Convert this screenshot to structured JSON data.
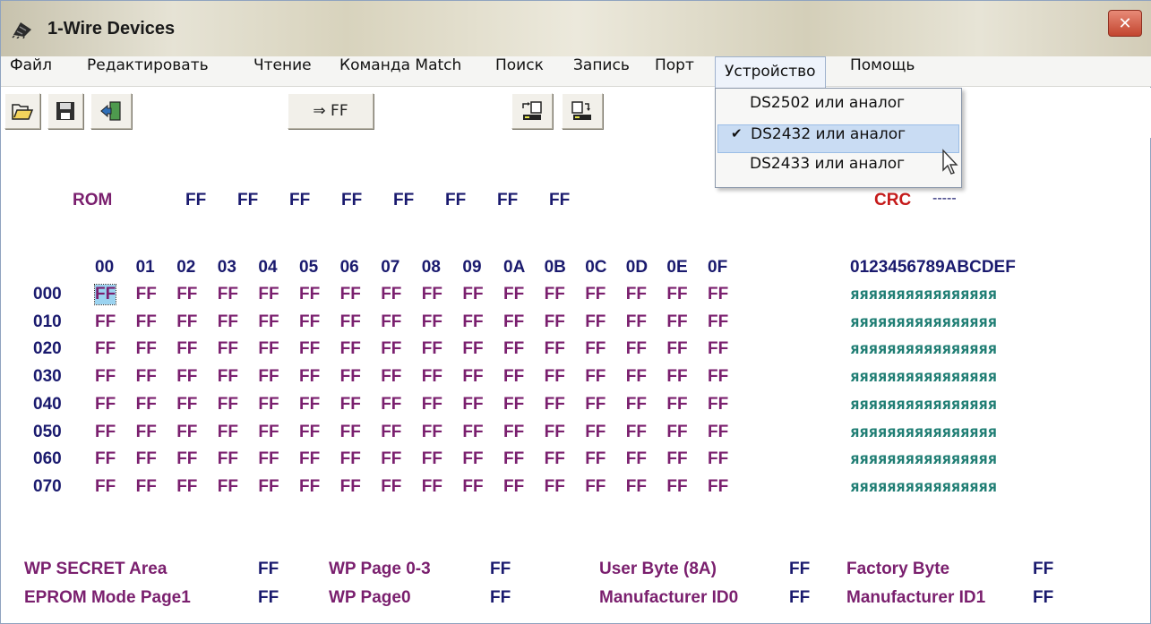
{
  "window": {
    "title": "1-Wire Devices",
    "close_glyph": "✕"
  },
  "menu": [
    "Файл",
    "Редактировать",
    "Чтение",
    "Команда Match",
    "Поиск",
    "Запись",
    "Порт",
    "Устройство",
    "Помощь"
  ],
  "toolbar": {
    "ff_button_label": "⇒ FF",
    "icons": [
      "open-folder-icon",
      "save-disk-icon",
      "exit-door-icon",
      "read-to-device-icon",
      "write-from-device-icon"
    ]
  },
  "device_menu": {
    "items": [
      "DS2502 или аналог",
      "DS2432 или аналог",
      "DS2433 или аналог"
    ],
    "checked_index": 1,
    "check_glyph": "✔"
  },
  "rom": {
    "label": "ROM",
    "bytes": [
      "FF",
      "FF",
      "FF",
      "FF",
      "FF",
      "FF",
      "FF",
      "FF"
    ],
    "crc_label": "CRC",
    "crc_value": "-----"
  },
  "memory": {
    "column_headers": [
      "00",
      "01",
      "02",
      "03",
      "04",
      "05",
      "06",
      "07",
      "08",
      "09",
      "0A",
      "0B",
      "0C",
      "0D",
      "0E",
      "0F"
    ],
    "ascii_header": "0123456789ABCDEF",
    "rows": [
      {
        "address": "000",
        "bytes": [
          "FF",
          "FF",
          "FF",
          "FF",
          "FF",
          "FF",
          "FF",
          "FF",
          "FF",
          "FF",
          "FF",
          "FF",
          "FF",
          "FF",
          "FF",
          "FF"
        ],
        "ascii": "яяяяяяяяяяяяяяяя"
      },
      {
        "address": "010",
        "bytes": [
          "FF",
          "FF",
          "FF",
          "FF",
          "FF",
          "FF",
          "FF",
          "FF",
          "FF",
          "FF",
          "FF",
          "FF",
          "FF",
          "FF",
          "FF",
          "FF"
        ],
        "ascii": "яяяяяяяяяяяяяяяя"
      },
      {
        "address": "020",
        "bytes": [
          "FF",
          "FF",
          "FF",
          "FF",
          "FF",
          "FF",
          "FF",
          "FF",
          "FF",
          "FF",
          "FF",
          "FF",
          "FF",
          "FF",
          "FF",
          "FF"
        ],
        "ascii": "яяяяяяяяяяяяяяяя"
      },
      {
        "address": "030",
        "bytes": [
          "FF",
          "FF",
          "FF",
          "FF",
          "FF",
          "FF",
          "FF",
          "FF",
          "FF",
          "FF",
          "FF",
          "FF",
          "FF",
          "FF",
          "FF",
          "FF"
        ],
        "ascii": "яяяяяяяяяяяяяяяя"
      },
      {
        "address": "040",
        "bytes": [
          "FF",
          "FF",
          "FF",
          "FF",
          "FF",
          "FF",
          "FF",
          "FF",
          "FF",
          "FF",
          "FF",
          "FF",
          "FF",
          "FF",
          "FF",
          "FF"
        ],
        "ascii": "яяяяяяяяяяяяяяяя"
      },
      {
        "address": "050",
        "bytes": [
          "FF",
          "FF",
          "FF",
          "FF",
          "FF",
          "FF",
          "FF",
          "FF",
          "FF",
          "FF",
          "FF",
          "FF",
          "FF",
          "FF",
          "FF",
          "FF"
        ],
        "ascii": "яяяяяяяяяяяяяяяя"
      },
      {
        "address": "060",
        "bytes": [
          "FF",
          "FF",
          "FF",
          "FF",
          "FF",
          "FF",
          "FF",
          "FF",
          "FF",
          "FF",
          "FF",
          "FF",
          "FF",
          "FF",
          "FF",
          "FF"
        ],
        "ascii": "яяяяяяяяяяяяяяяя"
      },
      {
        "address": "070",
        "bytes": [
          "FF",
          "FF",
          "FF",
          "FF",
          "FF",
          "FF",
          "FF",
          "FF",
          "FF",
          "FF",
          "FF",
          "FF",
          "FF",
          "FF",
          "FF",
          "FF"
        ],
        "ascii": "яяяяяяяяяяяяяяяя"
      }
    ],
    "selected_cell": {
      "row": 0,
      "col": 0
    }
  },
  "status_fields": [
    {
      "label": "WP SECRET Area",
      "value": "FF"
    },
    {
      "label": "WP Page 0-3",
      "value": "FF"
    },
    {
      "label": "User Byte (8A)",
      "value": "FF"
    },
    {
      "label": "Factory Byte",
      "value": "FF"
    },
    {
      "label": "EPROM Mode Page1",
      "value": "FF"
    },
    {
      "label": "WP Page0",
      "value": "FF"
    },
    {
      "label": "Manufacturer ID0",
      "value": "FF"
    },
    {
      "label": "Manufacturer ID1",
      "value": "FF"
    }
  ],
  "colors": {
    "rom_label": "#7a1f6e",
    "hex_values": "#1a1a6e",
    "crc_label": "#c51a1a",
    "memory_data": "#7a1f6e",
    "ascii": "#1e7d73",
    "selection": "#9bd3f0"
  }
}
